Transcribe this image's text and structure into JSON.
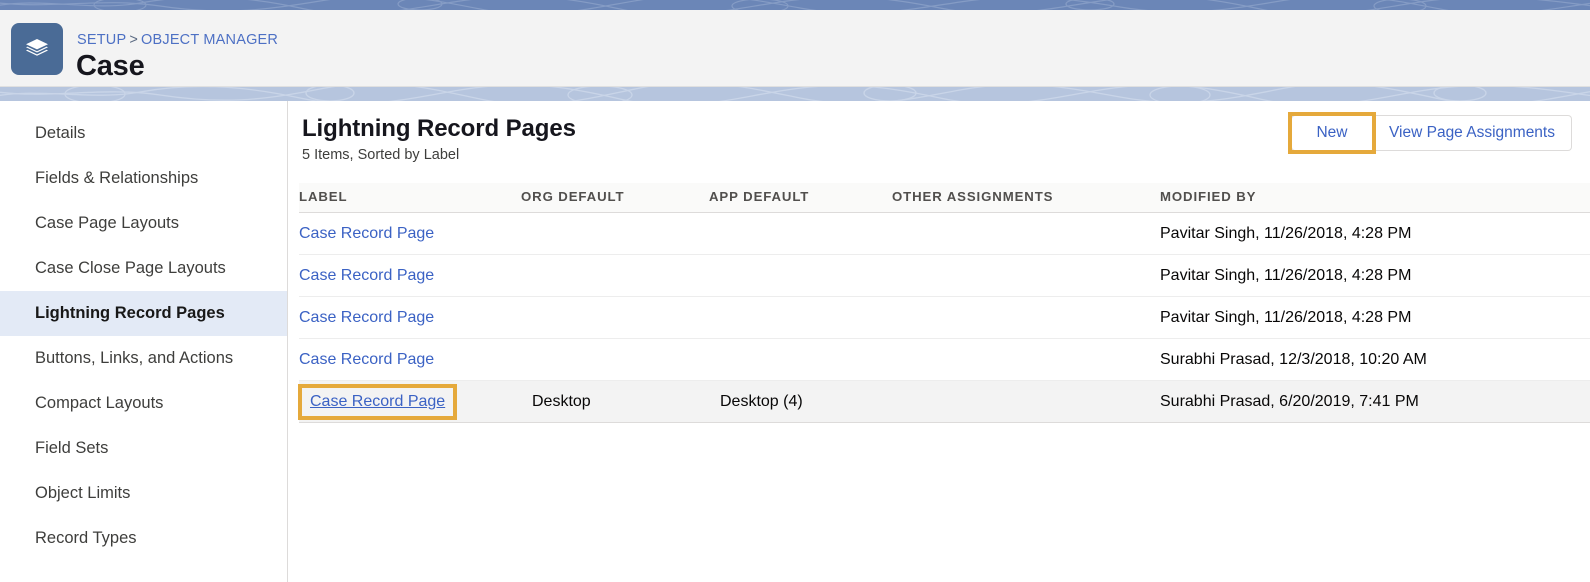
{
  "header": {
    "app_icon": "layers-stack-icon",
    "breadcrumb": {
      "root": "SETUP",
      "separator": ">",
      "current": "OBJECT MANAGER"
    },
    "object_title": "Case"
  },
  "sidebar": {
    "items": [
      {
        "label": "Details",
        "active": false
      },
      {
        "label": "Fields & Relationships",
        "active": false
      },
      {
        "label": "Case Page Layouts",
        "active": false
      },
      {
        "label": "Case Close Page Layouts",
        "active": false
      },
      {
        "label": "Lightning Record Pages",
        "active": true
      },
      {
        "label": "Buttons, Links, and Actions",
        "active": false
      },
      {
        "label": "Compact Layouts",
        "active": false
      },
      {
        "label": "Field Sets",
        "active": false
      },
      {
        "label": "Object Limits",
        "active": false
      },
      {
        "label": "Record Types",
        "active": false
      }
    ]
  },
  "main": {
    "title": "Lightning Record Pages",
    "subtitle": "5 Items, Sorted by Label",
    "buttons": {
      "new": "New",
      "view_page_assignments": "View Page Assignments"
    },
    "table": {
      "columns": [
        "LABEL",
        "ORG DEFAULT",
        "APP DEFAULT",
        "OTHER ASSIGNMENTS",
        "MODIFIED BY"
      ],
      "rows": [
        {
          "label": "Case Record Page",
          "org_default": "",
          "app_default": "",
          "other_assignments": "",
          "modified_by": "Pavitar Singh, 11/26/2018, 4:28 PM"
        },
        {
          "label": "Case Record Page",
          "org_default": "",
          "app_default": "",
          "other_assignments": "",
          "modified_by": "Pavitar Singh, 11/26/2018, 4:28 PM"
        },
        {
          "label": "Case Record Page",
          "org_default": "",
          "app_default": "",
          "other_assignments": "",
          "modified_by": "Pavitar Singh, 11/26/2018, 4:28 PM"
        },
        {
          "label": "Case Record Page",
          "org_default": "",
          "app_default": "",
          "other_assignments": "",
          "modified_by": "Surabhi Prasad, 12/3/2018, 10:20 AM"
        },
        {
          "label": "Case Record Page",
          "org_default": "Desktop",
          "app_default": "Desktop (4)",
          "other_assignments": "",
          "modified_by": "Surabhi Prasad, 6/20/2019, 7:41 PM"
        }
      ]
    }
  },
  "colors": {
    "link_blue": "#3b62c4",
    "breadcrumb_blue": "#4d70c4",
    "highlight_gold": "#e5a93b",
    "band_top_blue": "#6b86b7",
    "band_mid_blue": "#b6c5de",
    "app_icon_blue": "#4a6b96",
    "active_nav_bg": "#e3eaf6",
    "selected_row_bg": "#f3f3f3"
  }
}
